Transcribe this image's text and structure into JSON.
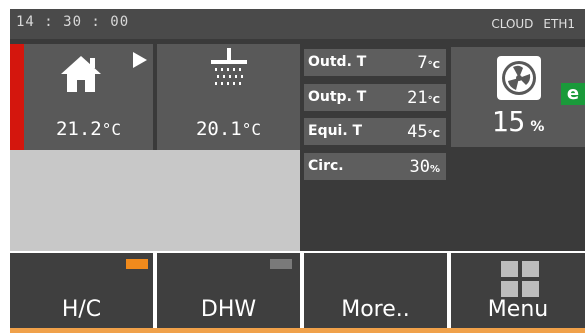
{
  "status_bar": {
    "time": "14 : 30 : 00",
    "cloud": "CLOUD",
    "eth": "ETH1"
  },
  "zones": [
    {
      "name": "house",
      "value": "21.2",
      "unit": "°C"
    },
    {
      "name": "dhw",
      "value": "20.1",
      "unit": "°C"
    }
  ],
  "readings": [
    {
      "label": "Outd. T",
      "value": "7",
      "unit": "°C"
    },
    {
      "label": "Outp. T",
      "value": "21",
      "unit": "°C"
    },
    {
      "label": "Equi. T",
      "value": "45",
      "unit": "°C"
    },
    {
      "label": "Circ.",
      "value": "30",
      "unit": "%"
    }
  ],
  "fan": {
    "value": "15",
    "unit": "%",
    "badge": "e"
  },
  "buttons": [
    {
      "label": "H/C",
      "indicator_color": "#f08a1c"
    },
    {
      "label": "DHW",
      "indicator_color": "#7a7a7a"
    },
    {
      "label": "More.."
    },
    {
      "label": "Menu"
    }
  ],
  "colors": {
    "accent_red": "#d4160d",
    "accent_orange": "#f08a1c",
    "badge_green": "#1a9a3a"
  }
}
